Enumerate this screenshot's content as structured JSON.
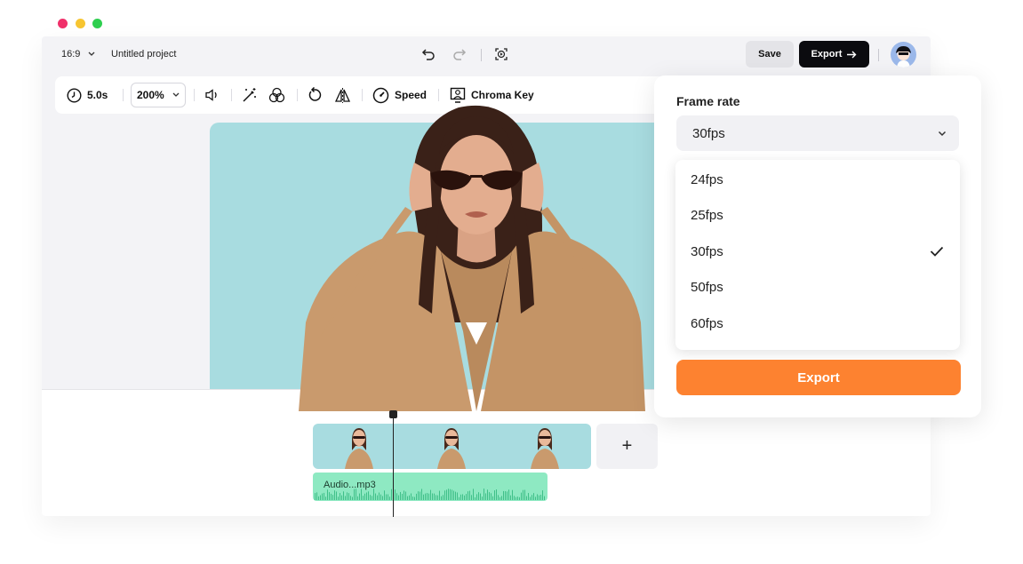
{
  "window": {
    "dots": [
      "#f0306a",
      "#f7c531",
      "#2ecf4f"
    ]
  },
  "topbar": {
    "aspect_ratio": "16:9",
    "project_name": "Untitled project",
    "save_label": "Save",
    "export_label": "Export"
  },
  "toolbar": {
    "duration": "5.0s",
    "zoom": "200%",
    "speed_label": "Speed",
    "chroma_key_label": "Chroma Key"
  },
  "timeline": {
    "audio_label": "Audio...mp3",
    "add_label": "+"
  },
  "export_panel": {
    "title": "Frame rate",
    "selected": "30fps",
    "options": [
      "24fps",
      "25fps",
      "30fps",
      "50fps",
      "60fps"
    ],
    "checked_index": 2,
    "export_button": "Export"
  },
  "colors": {
    "accent": "#fd8230",
    "canvas_bg": "#a8dce0",
    "audio_track": "#8ee9c2",
    "coat": "#c99a6d"
  }
}
